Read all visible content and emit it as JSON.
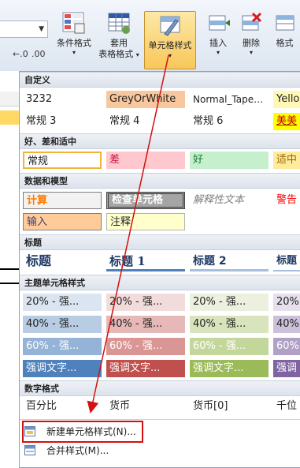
{
  "ribbon": {
    "buttons": [
      {
        "id": "conditional",
        "label": "条件格式",
        "has_dropdown": true
      },
      {
        "id": "table",
        "label": "套用\n表格格式",
        "has_dropdown": true
      },
      {
        "id": "cellstyles",
        "label": "单元格样式",
        "has_dropdown": true
      },
      {
        "id": "insert",
        "label": "插入",
        "has_dropdown": true
      },
      {
        "id": "delete",
        "label": "删除",
        "has_dropdown": true
      },
      {
        "id": "format",
        "label": "格式",
        "has_dropdown": false
      }
    ],
    "conditional_label": "条件格式",
    "table_label_1": "套用",
    "table_label_2": "表格格式",
    "cellstyles_label": "单元格样式",
    "insert_label": "插入",
    "delete_label": "删除",
    "format_label": "格式",
    "number_format_icons": "←.0 .00"
  },
  "sections": {
    "custom": "自定义",
    "good_bad": "好、差和适中",
    "data_model": "数据和模型",
    "titles": "标题",
    "theme": "主题单元格样式",
    "number": "数字格式"
  },
  "custom_row1": [
    "3232",
    "GreyOrWhite",
    "Normal_Tape…",
    "Yello"
  ],
  "custom_row2": [
    "常规 3",
    "常规 4",
    "常规  6",
    "美美"
  ],
  "good_bad_row": [
    "常规",
    "差",
    "好",
    "适中"
  ],
  "data_row1": [
    "计算",
    "检查单元格",
    "解释性文本",
    "警告"
  ],
  "data_row2": [
    "输入",
    "注释"
  ],
  "titles_row": [
    "标题",
    "标题 1",
    "标题 2",
    "标题"
  ],
  "theme_rows": [
    [
      "20% - 强...",
      "20% - 强...",
      "20% - 强...",
      "20%"
    ],
    [
      "40% - 强...",
      "40% - 强...",
      "40% - 强...",
      "40%"
    ],
    [
      "60% - 强...",
      "60% - 强...",
      "60% - 强...",
      "60%"
    ],
    [
      "强调文字...",
      "强调文字...",
      "强调文字...",
      "强调"
    ]
  ],
  "number_row": [
    "百分比",
    "货币",
    "货币[0]",
    "千位"
  ],
  "menu": {
    "new_style": "新建单元格样式(N)...",
    "merge_styles": "合并样式(M)..."
  },
  "colors": {
    "annotation_red": "#d41010",
    "active_button": "#f8c75a"
  }
}
